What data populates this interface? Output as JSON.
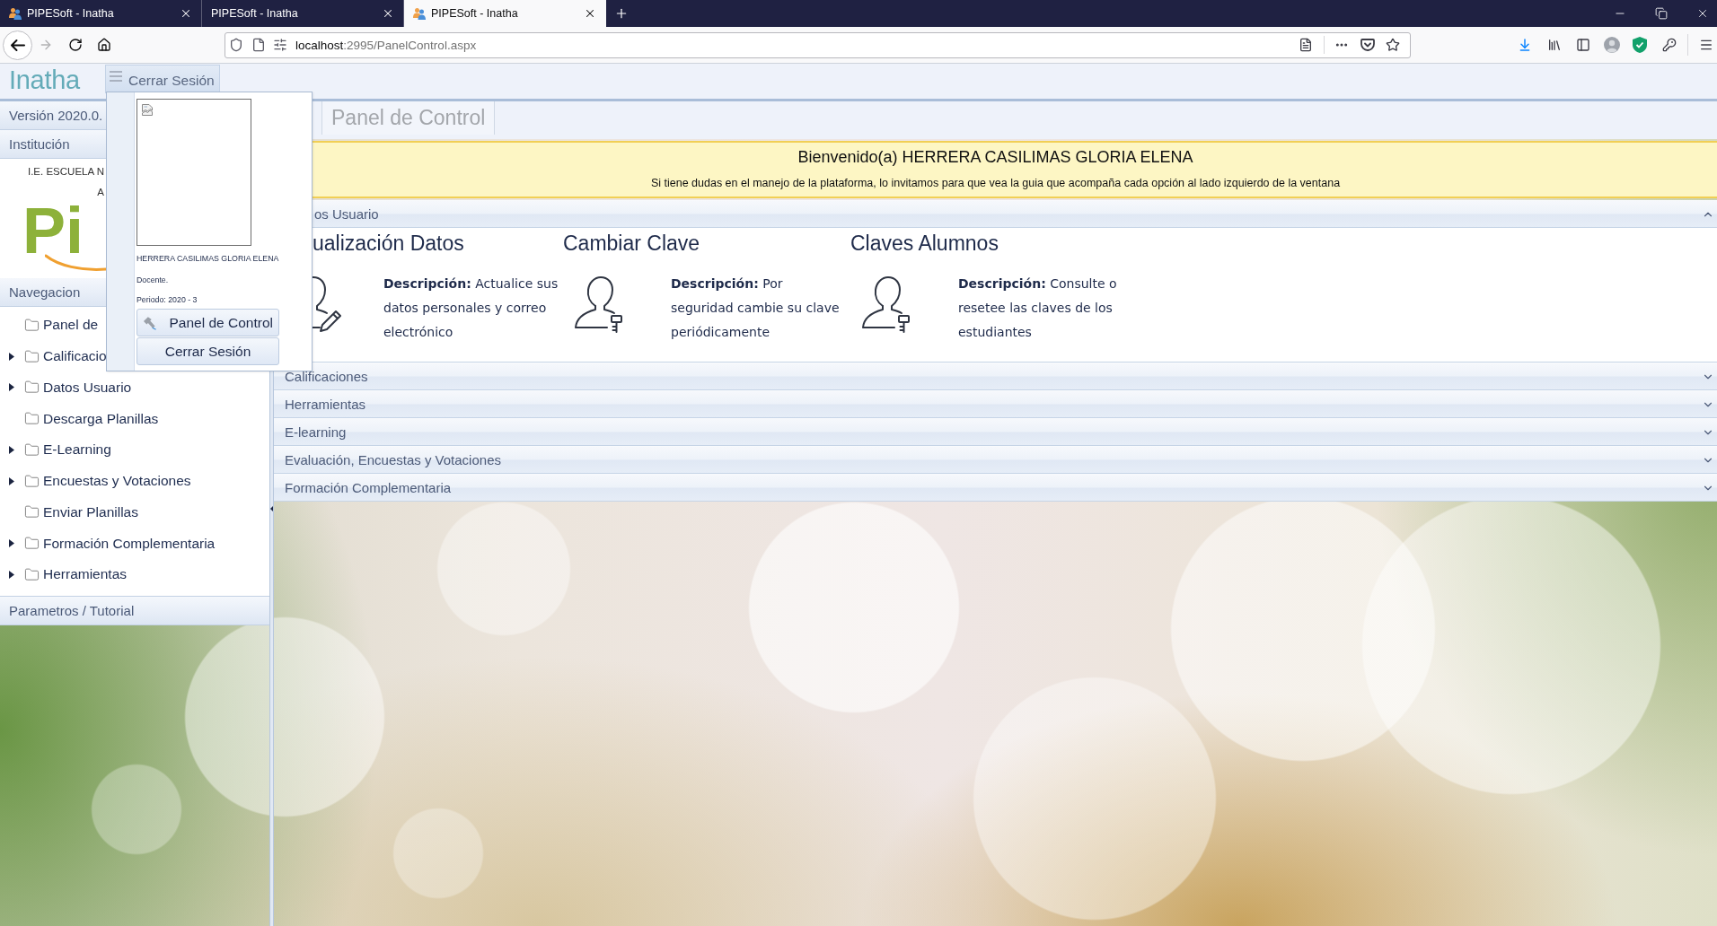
{
  "browser": {
    "tabs": [
      {
        "title": "PIPESoft - Inatha",
        "favicon": true,
        "selected": false
      },
      {
        "title": "PIPESoft - Inatha",
        "favicon": false,
        "selected": false
      },
      {
        "title": "PIPESoft - Inatha",
        "favicon": true,
        "selected": true
      }
    ],
    "url": {
      "host": "localhost",
      "path": ":2995/PanelControl.aspx"
    }
  },
  "header": {
    "logo": "Inatha",
    "menu_button": {
      "label": "Cerrar Sesión",
      "open": true
    }
  },
  "user_menu": {
    "name": "HERRERA CASILIMAS GLORIA ELENA",
    "role": "Docente.",
    "period": "Periodo: 2020 - 3",
    "items": [
      {
        "label": "Panel de Control",
        "kind": "tool"
      },
      {
        "label": "Cerrar Sesión",
        "kind": "plain"
      }
    ]
  },
  "sidebar": {
    "version": "Versión 2020.0.",
    "institution": {
      "title": "Institución",
      "name_lines": [
        "I.E. ESCUELA N",
        "A"
      ],
      "logo": "Pi"
    },
    "navigation": {
      "title": "Navegacion",
      "items": [
        {
          "label": "Panel de",
          "kind": "leaf"
        },
        {
          "label": "Calificacio",
          "kind": "branch",
          "expanded": false
        },
        {
          "label": "Datos Usuario",
          "kind": "branch",
          "expanded": false
        },
        {
          "label": "Descarga Planillas",
          "kind": "leaf"
        },
        {
          "label": "E-Learning",
          "kind": "branch",
          "expanded": false
        },
        {
          "label": "Encuestas y Votaciones",
          "kind": "branch",
          "expanded": false
        },
        {
          "label": "Enviar Planillas",
          "kind": "leaf"
        },
        {
          "label": "Formación Complementaria",
          "kind": "branch",
          "expanded": false
        },
        {
          "label": "Herramientas",
          "kind": "branch",
          "expanded": false
        }
      ]
    },
    "footer": "Parametros / Tutorial"
  },
  "main": {
    "tabs": [
      {
        "label": "Panel de Control",
        "selected": true
      }
    ],
    "welcome": {
      "title": "Bienvenido(a) HERRERA CASILIMAS GLORIA ELENA",
      "message": "Si tiene dudas en el manejo de la plataforma, lo invitamos para que vea la guia que acompaña cada opción al lado izquierdo de la ventana"
    },
    "sections": [
      {
        "title": "os Usuario",
        "expanded": true,
        "cards": [
          {
            "kind": "edit",
            "title": "ualización Datos",
            "description": "**Descripción:** Actualice sus datos personales y correo electrónico"
          },
          {
            "kind": "key",
            "title": "Cambiar Clave",
            "description": "**Descripción:** Por seguridad cambie su clave periódicamente"
          },
          {
            "kind": "key",
            "title": "Claves Alumnos",
            "description": "**Descripción:** Consulte o resetee las claves de los estudiantes"
          }
        ]
      },
      {
        "title": "Calificaciones",
        "expanded": false
      },
      {
        "title": "Herramientas",
        "expanded": false
      },
      {
        "title": "E-learning",
        "expanded": false
      },
      {
        "title": "Evaluación, Encuestas y Votaciones",
        "expanded": false
      },
      {
        "title": "Formación Complementaria",
        "expanded": false
      }
    ]
  }
}
